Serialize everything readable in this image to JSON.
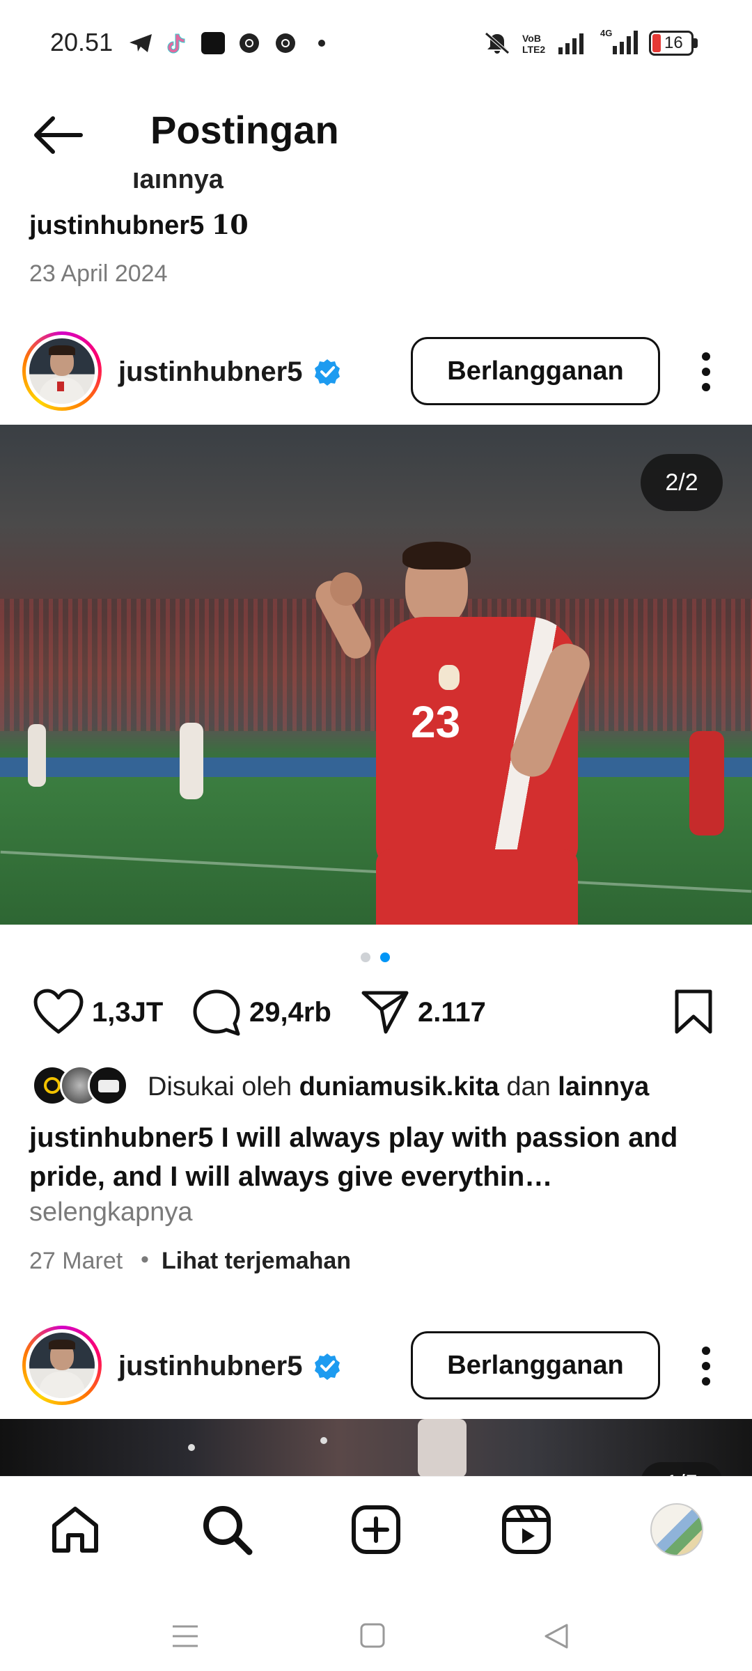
{
  "status_bar": {
    "time": "20.51",
    "battery": "16",
    "network": "4G",
    "volte": "VoB LTE2"
  },
  "header": {
    "title": "Postingan"
  },
  "previous_post": {
    "cut_text": "lainnya",
    "caption_user": "justinhubner5",
    "caption_text": "10",
    "date": "23 April 2024"
  },
  "post": {
    "username": "justinhubner5",
    "subscribe_label": "Berlangganan",
    "image_counter": "2/2",
    "likes": "1,3JT",
    "comments": "29,4rb",
    "shares": "2.117",
    "liked_by_prefix": "Disukai oleh",
    "liked_by_user": "duniamusik.kita",
    "liked_by_mid": "dan",
    "liked_by_suffix": "lainnya",
    "caption_user": "justinhubner5",
    "caption_text": "I will always play with passion and pride, and I will always give everythin…",
    "more_label": "selengkapnya",
    "date": "27 Maret",
    "separator": "•",
    "translate_label": "Lihat terjemahan",
    "colors": {
      "verified": "#1d9bf0",
      "active_dot": "#0095f6"
    }
  },
  "next_post": {
    "username": "justinhubner5",
    "subscribe_label": "Berlangganan",
    "image_counter": "1/5"
  },
  "bottom_nav": {
    "items": [
      "home-icon",
      "search-icon",
      "create-icon",
      "reels-icon",
      "profile-avatar"
    ]
  },
  "system_nav": {
    "items": [
      "recents-icon",
      "home-button-icon",
      "back-triangle-icon"
    ]
  }
}
